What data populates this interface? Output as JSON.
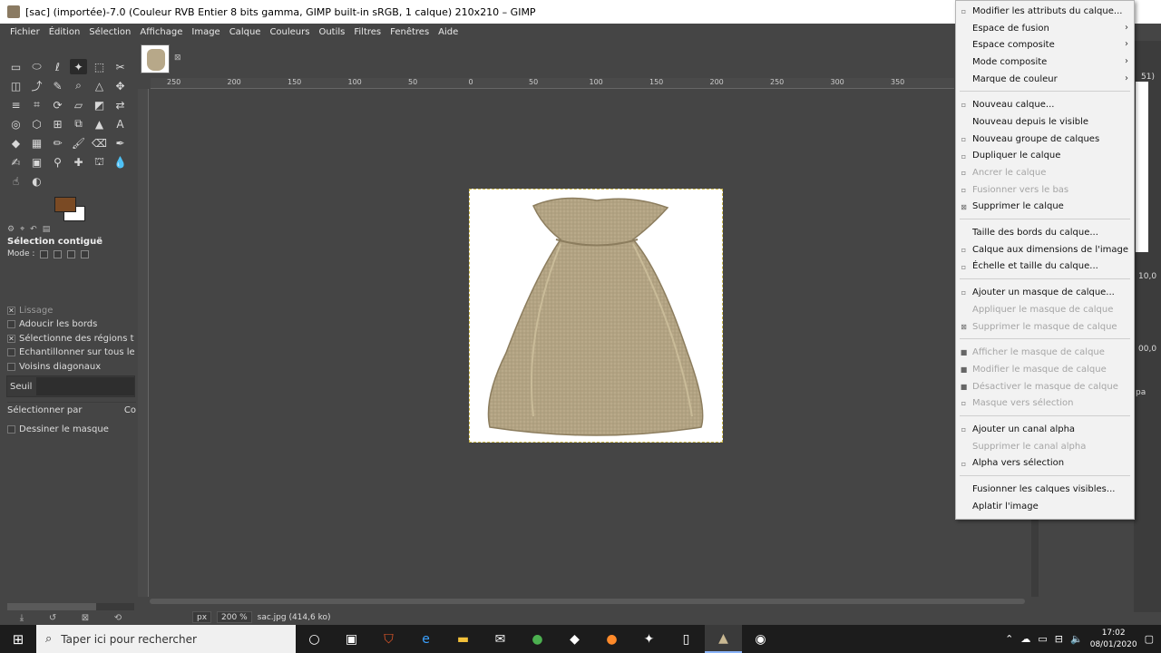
{
  "window": {
    "title": "[sac] (importée)-7.0 (Couleur RVB Entier 8 bits gamma, GIMP built-in sRGB, 1 calque) 210x210 – GIMP"
  },
  "menubar": [
    "Fichier",
    "Édition",
    "Sélection",
    "Affichage",
    "Image",
    "Calque",
    "Couleurs",
    "Outils",
    "Filtres",
    "Fenêtres",
    "Aide"
  ],
  "toolbox": {
    "colors": {
      "foreground": "#7a4a24",
      "background": "#ffffff"
    },
    "tool_options_title": "Sélection contiguë",
    "mode_label": "Mode :",
    "options": [
      {
        "label": "Lissage",
        "checked": true,
        "dim": true
      },
      {
        "label": "Adoucir les bords",
        "checked": false,
        "dim": false
      },
      {
        "label": "Sélectionne des régions tra",
        "checked": true,
        "dim": false
      },
      {
        "label": "Échantillonner sur tous les c",
        "checked": false,
        "dim": false
      },
      {
        "label": "Voisins diagonaux",
        "checked": false,
        "dim": false
      }
    ],
    "threshold_label": "Seuil",
    "select_by_label": "Sélectionner par",
    "select_by_value": "Co",
    "draw_mask_label": "Dessiner le masque"
  },
  "ruler": {
    "h_ticks": [
      "250",
      "200",
      "150",
      "100",
      "50",
      "0",
      "50",
      "100",
      "150",
      "200",
      "250",
      "300",
      "350"
    ]
  },
  "statusbar": {
    "unit": "px",
    "zoom": "200 %",
    "file_info": "sac.jpg (414,6 ko)"
  },
  "context_menu": {
    "items": [
      {
        "label": "Modifier les attributs du calque...",
        "dim": false,
        "icon": "edit-icon",
        "submenu": false
      },
      {
        "label": "Espace de fusion",
        "dim": false,
        "icon": "",
        "submenu": true
      },
      {
        "label": "Espace composite",
        "dim": false,
        "icon": "",
        "submenu": true
      },
      {
        "label": "Mode composite",
        "dim": false,
        "icon": "",
        "submenu": true
      },
      {
        "label": "Marque de couleur",
        "dim": false,
        "icon": "",
        "submenu": true
      },
      {
        "sep": true
      },
      {
        "label": "Nouveau calque...",
        "dim": false,
        "icon": "new-layer-icon",
        "submenu": false
      },
      {
        "label": "Nouveau depuis le visible",
        "dim": false,
        "icon": "",
        "submenu": false
      },
      {
        "label": "Nouveau groupe de calques",
        "dim": false,
        "icon": "layer-group-icon",
        "submenu": false
      },
      {
        "label": "Dupliquer le calque",
        "dim": false,
        "icon": "duplicate-icon",
        "submenu": false
      },
      {
        "label": "Ancrer le calque",
        "dim": true,
        "icon": "anchor-icon",
        "submenu": false
      },
      {
        "label": "Fusionner vers le bas",
        "dim": true,
        "icon": "merge-down-icon",
        "submenu": false
      },
      {
        "label": "Supprimer le calque",
        "dim": false,
        "icon": "delete-icon",
        "submenu": false
      },
      {
        "sep": true
      },
      {
        "label": "Taille des bords du calque...",
        "dim": false,
        "icon": "",
        "submenu": false
      },
      {
        "label": "Calque aux dimensions de l'image",
        "dim": false,
        "icon": "layer-to-image-size-icon",
        "submenu": false
      },
      {
        "label": "Échelle et taille du calque...",
        "dim": false,
        "icon": "scale-layer-icon",
        "submenu": false
      },
      {
        "sep": true
      },
      {
        "label": "Ajouter un masque de calque...",
        "dim": false,
        "icon": "add-mask-icon",
        "submenu": false
      },
      {
        "label": "Appliquer le masque de calque",
        "dim": true,
        "icon": "",
        "submenu": false
      },
      {
        "label": "Supprimer le masque de calque",
        "dim": true,
        "icon": "delete-mask-icon",
        "submenu": false
      },
      {
        "sep": true
      },
      {
        "label": "Afficher le masque de calque",
        "dim": true,
        "icon": "checkbox-icon",
        "submenu": false
      },
      {
        "label": "Modifier le masque de calque",
        "dim": true,
        "icon": "checkbox-icon",
        "submenu": false
      },
      {
        "label": "Désactiver le masque de calque",
        "dim": true,
        "icon": "checkbox-icon",
        "submenu": false
      },
      {
        "label": "Masque vers sélection",
        "dim": true,
        "icon": "mask-to-selection-icon",
        "submenu": false
      },
      {
        "sep": true
      },
      {
        "label": "Ajouter un canal alpha",
        "dim": false,
        "icon": "alpha-icon",
        "submenu": false
      },
      {
        "label": "Supprimer le canal alpha",
        "dim": true,
        "icon": "",
        "submenu": false
      },
      {
        "label": "Alpha vers sélection",
        "dim": false,
        "icon": "alpha-to-selection-icon",
        "submenu": false
      },
      {
        "sep": true
      },
      {
        "label": "Fusionner les calques visibles...",
        "dim": false,
        "icon": "",
        "submenu": false
      },
      {
        "label": "Aplatir l'image",
        "dim": false,
        "icon": "",
        "submenu": false
      }
    ]
  },
  "right_dock": {
    "value1": "10,0",
    "value2": "00,0",
    "partial_label": "pa",
    "partial_top": "51)"
  },
  "taskbar": {
    "search_placeholder": "Taper ici pour rechercher",
    "time": "17:02",
    "date": "08/01/2020"
  }
}
